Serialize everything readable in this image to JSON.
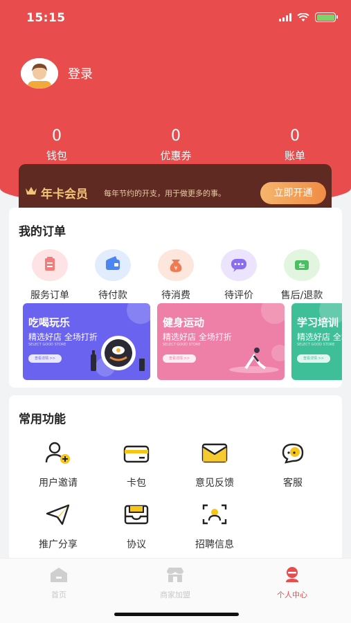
{
  "status_bar": {
    "time": "15:15"
  },
  "profile": {
    "login_label": "登录"
  },
  "stats": [
    {
      "value": "0",
      "label": "钱包"
    },
    {
      "value": "0",
      "label": "优惠券"
    },
    {
      "value": "0",
      "label": "账单"
    }
  ],
  "vip": {
    "title": "年卡会员",
    "description": "每年节约的开支，用于做更多的事。",
    "button_label": "立即开通"
  },
  "orders": {
    "title": "我的订单",
    "items": [
      {
        "label": "服务订单",
        "icon": "clipboard-icon",
        "bg": "#fde3e3",
        "color": "#f07c7c"
      },
      {
        "label": "待付款",
        "icon": "wallet-icon",
        "bg": "#e1ecfc",
        "color": "#4c86f0"
      },
      {
        "label": "待消费",
        "icon": "money-bag-icon",
        "bg": "#fde6dc",
        "color": "#ef7b52"
      },
      {
        "label": "待评价",
        "icon": "chat-bubble-icon",
        "bg": "#ebe4fc",
        "color": "#8a6cf0"
      },
      {
        "label": "售后/退款",
        "icon": "refund-icon",
        "bg": "#e2f6df",
        "color": "#4cbf62"
      }
    ]
  },
  "banners": [
    {
      "title": "吃喝玩乐",
      "subtitle": "精选好店 全场打折",
      "en": "SELECT GOOD STORE",
      "button": "查看详情 >>",
      "color": "#6a63f0"
    },
    {
      "title": "健身运动",
      "subtitle": "精选好店 全场打折",
      "en": "SELECT GOOD STORE",
      "button": "查看详情 >>",
      "color": "#ee7fa6"
    },
    {
      "title": "学习培训",
      "subtitle": "精选好店 全场打折",
      "en": "SELECT GOOD STORE",
      "button": "查看详情 >>",
      "color": "#3fbf98"
    }
  ],
  "functions": {
    "title": "常用功能",
    "items": [
      {
        "label": "用户邀请",
        "icon": "add-user-icon"
      },
      {
        "label": "卡包",
        "icon": "card-icon"
      },
      {
        "label": "意见反馈",
        "icon": "envelope-icon"
      },
      {
        "label": "客服",
        "icon": "customer-service-icon"
      },
      {
        "label": "推广分享",
        "icon": "send-icon"
      },
      {
        "label": "协议",
        "icon": "inbox-icon"
      },
      {
        "label": "招聘信息",
        "icon": "scan-person-icon"
      }
    ]
  },
  "tabbar": {
    "items": [
      {
        "label": "首页",
        "icon": "home-icon",
        "active": false
      },
      {
        "label": "商家加盟",
        "icon": "store-icon",
        "active": false
      },
      {
        "label": "个人中心",
        "icon": "profile-icon",
        "active": true
      }
    ]
  },
  "colors": {
    "primary": "#e84c4c",
    "vip_gold": "#f4c37a",
    "accent": "#f5c518"
  }
}
